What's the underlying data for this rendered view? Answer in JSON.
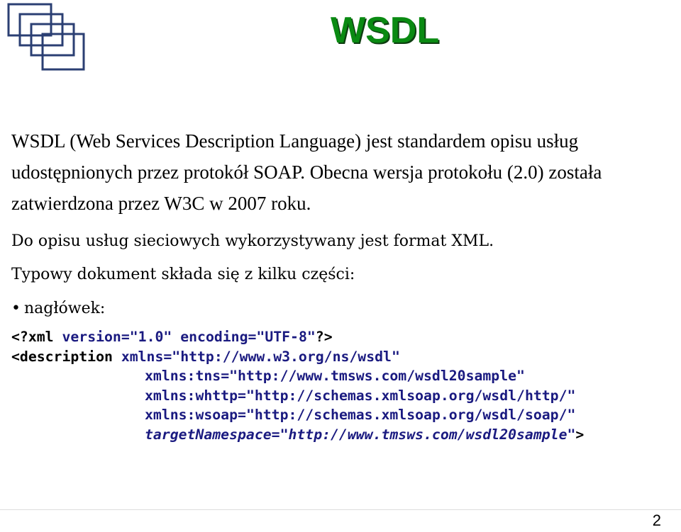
{
  "slide": {
    "title": "WSDL",
    "title_color": "#0a8a12",
    "paragraph": "WSDL (Web Services Description Language) jest standardem opisu usług udostępnionych przez protokół SOAP. Obecna wersja protokołu (2.0) została zatwierdzona przez W3C w 2007 roku.",
    "line1": "Do opisu usług sieciowych wykorzystywany jest format XML.",
    "line2": "Typowy dokument składa się z kilku części:",
    "bullet_icon": "bullet-dot",
    "bullet": "nagłówek:",
    "code": {
      "l1_open": "<?xml ",
      "l1_attr1": "version",
      "l1_eq1": "=",
      "l1_val1": "\"1.0\"",
      "l1_attr2": " encoding",
      "l1_eq2": "=",
      "l1_val2": "\"UTF-8\"",
      "l1_close": "?>",
      "l2_open": "<description ",
      "l2_attr": "xmlns",
      "l2_eq": "=",
      "l2_val": "\"http://www.w3.org/ns/wsdl\"",
      "l3_attr": "xmlns:tns",
      "l3_eq": "=",
      "l3_val": "\"http://www.tmsws.com/wsdl20sample\"",
      "l4_attr": "xmlns:whttp",
      "l4_eq": "=",
      "l4_val": "\"http://schemas.xmlsoap.org/wsdl/http/\"",
      "l5_attr": "xmlns:wsoap",
      "l5_eq": "=",
      "l5_val": "\"http://schemas.xmlsoap.org/wsdl/soap/\"",
      "l6_attr": "targetNamespace",
      "l6_eq": "=",
      "l6_val": "\"http://www.tmsws.com/wsdl20sample\"",
      "l6_close": ">"
    },
    "page_number": "2",
    "logo_icon": "overlapping-squares-logo"
  }
}
